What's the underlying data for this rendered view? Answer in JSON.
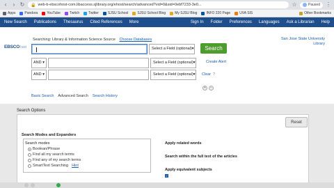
{
  "browser": {
    "url": "web-b-ebscohost-com.libaccess.sjlibrary.org/ehost/search/advanced?vid=0&sid=0ebf7233-3e0...",
    "profile_label": "Paused",
    "bookmarks": [
      {
        "label": "Apps",
        "color": "#5f6368"
      },
      {
        "label": "Pandora",
        "color": "#3668ff"
      },
      {
        "label": "YouTube",
        "color": "#ff0000"
      },
      {
        "label": "Twitch",
        "color": "#9146ff"
      },
      {
        "label": "Twitter",
        "color": "#1da1f2"
      },
      {
        "label": "SJSU School",
        "color": "#0055a2"
      },
      {
        "label": "SJSU School Blog",
        "color": "#e5a823"
      },
      {
        "label": "My SJSU Blog",
        "color": "#e5a823"
      },
      {
        "label": "INFO 220 Page",
        "color": "#0055a2"
      },
      {
        "label": "UVA SIS",
        "color": "#f27c00"
      }
    ],
    "other_bookmarks": "Other Bookmarks"
  },
  "topnav": {
    "left": [
      "New Search",
      "Publications",
      "Thesaurus",
      "Cited References",
      "More"
    ],
    "right": [
      "Sign In",
      "Folder",
      "Preferences",
      "Languages",
      "Ask a Librarian",
      "Help"
    ]
  },
  "search": {
    "logo_text": "EBSCO",
    "logo_host": "host",
    "searching_prefix": "Searching: Library & Information Science Source",
    "choose_databases": "Choose Databases",
    "boolean_op": "AND",
    "field_placeholder": "Select a Field (optional)",
    "search_button": "Search",
    "create_alert": "Create Alert",
    "clear": "Clear",
    "sjsu_label": "San Jose State University Library",
    "tabs": [
      "Basic Search",
      "Advanced Search",
      "Search History"
    ]
  },
  "options": {
    "title": "Search Options",
    "reset": "Reset",
    "section_title": "Search Modes and Expanders",
    "modes_title": "Search modes",
    "modes": [
      "Boolean/Phrase",
      "Find all my search terms",
      "Find any of my search terms",
      "SmartText Searching"
    ],
    "help_link": "Hint",
    "expanders": [
      "Apply related words",
      "Search within the full text of the articles",
      "Apply equivalent subjects"
    ]
  }
}
